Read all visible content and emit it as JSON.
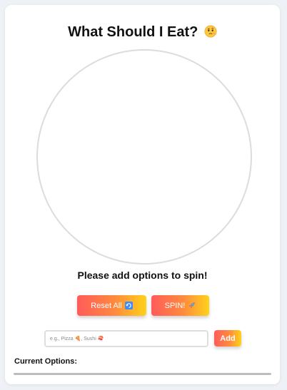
{
  "header": {
    "title": "What Should I Eat?",
    "title_emoji": "thinking-face-icon"
  },
  "wheel": {
    "message": "Please add options to spin!"
  },
  "controls": {
    "reset_label": "Reset All",
    "reset_icon": "refresh-icon",
    "spin_label": "SPIN!",
    "spin_icon": "rocket-icon"
  },
  "add_option": {
    "placeholder": "e.g., Pizza 🍕, Sushi 🍣",
    "value": "",
    "add_label": "Add"
  },
  "options": {
    "label": "Current Options:",
    "items": []
  },
  "colors": {
    "accent_start": "#ff5b5b",
    "accent_mid": "#ff8a3d",
    "accent_end": "#ffd21a",
    "background": "#eef1f6",
    "card": "#ffffff",
    "wheel_border": "#dcdcdc"
  }
}
